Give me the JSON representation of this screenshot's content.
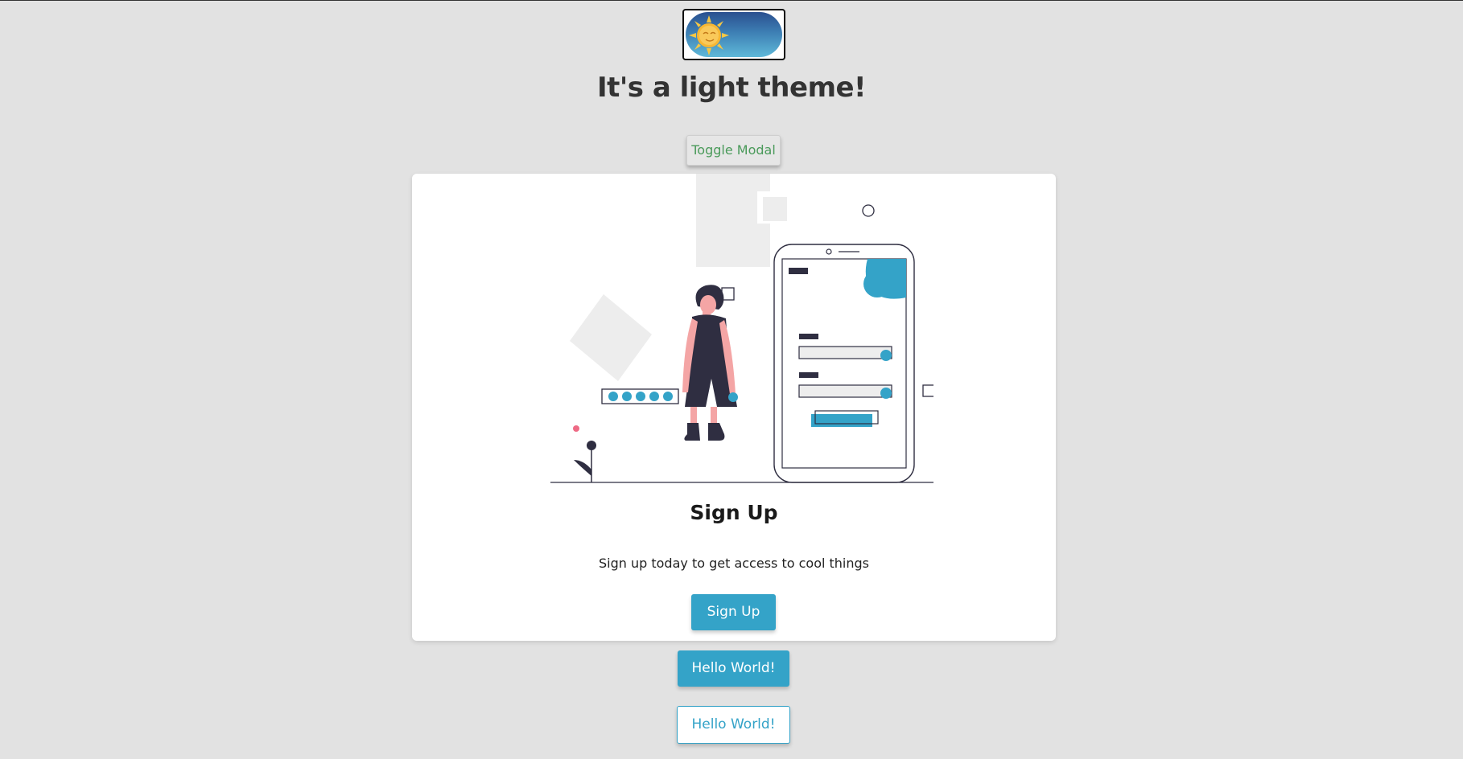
{
  "header": {
    "theme_toggle_state": "light",
    "title": "It's a light theme!"
  },
  "toolbar": {
    "toggle_modal_label": "Toggle Modal"
  },
  "card": {
    "title": "Sign Up",
    "text": "Sign up today to get access to cool things",
    "button_label": "Sign Up"
  },
  "buttons": {
    "hello_solid_label": "Hello World!",
    "hello_outline_label": "Hello World!"
  },
  "colors": {
    "background": "#e2e2e2",
    "accent": "#34a3c8",
    "toggle_text": "#4a9a5a",
    "dark_ink": "#2f2e41",
    "skin": "#f4a5a5"
  },
  "icons": {
    "theme": "sun-icon",
    "illustration": "sign-up-illustration"
  }
}
